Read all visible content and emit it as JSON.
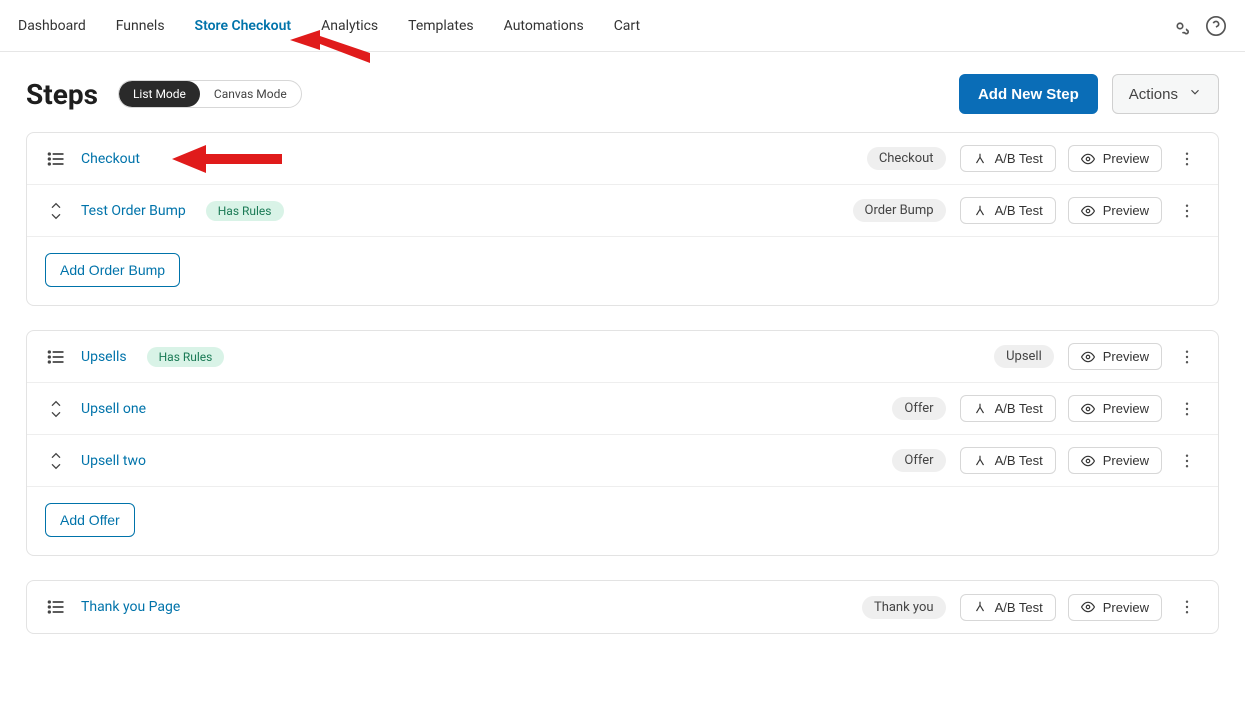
{
  "nav": {
    "tabs": {
      "dashboard": "Dashboard",
      "funnels": "Funnels",
      "store_checkout": "Store Checkout",
      "analytics": "Analytics",
      "templates": "Templates",
      "automations": "Automations",
      "cart": "Cart"
    },
    "active": "store_checkout"
  },
  "page": {
    "title": "Steps",
    "mode": {
      "list": "List Mode",
      "canvas": "Canvas Mode"
    },
    "add_new_step": "Add New Step",
    "actions": "Actions"
  },
  "buttons": {
    "abtest": "A/B Test",
    "preview": "Preview",
    "add_order_bump": "Add Order Bump",
    "add_offer": "Add Offer",
    "has_rules": "Has Rules"
  },
  "tags": {
    "checkout": "Checkout",
    "order_bump": "Order Bump",
    "upsell": "Upsell",
    "offer": "Offer",
    "thank_you": "Thank you"
  },
  "steps": {
    "checkout": "Checkout",
    "test_order_bump": "Test Order Bump",
    "upsells": "Upsells",
    "upsell_one": "Upsell one",
    "upsell_two": "Upsell two",
    "thank_you_page": "Thank you Page"
  }
}
